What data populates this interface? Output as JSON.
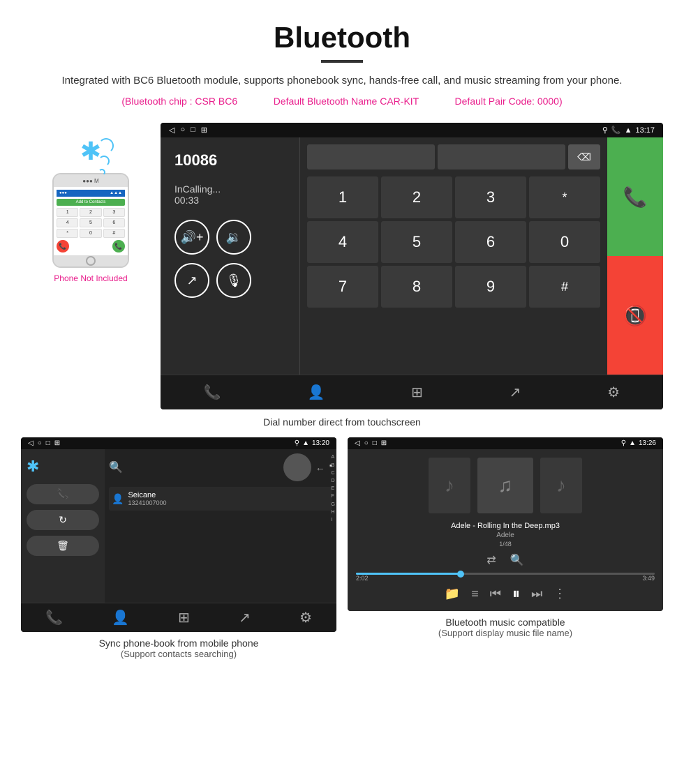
{
  "header": {
    "title": "Bluetooth",
    "description": "Integrated with BC6 Bluetooth module, supports phonebook sync, hands-free call, and music streaming from your phone.",
    "spec1": "(Bluetooth chip : CSR BC6",
    "spec2": "Default Bluetooth Name CAR-KIT",
    "spec3": "Default Pair Code: 0000)"
  },
  "phone": {
    "not_included": "Phone Not Included",
    "add_contacts": "Add to Contacts"
  },
  "car_screen": {
    "status": {
      "back": "◁",
      "home": "○",
      "recents": "□",
      "screenshot": "⊞",
      "location": "⚲",
      "phone": "📞",
      "signal": "▲",
      "time": "13:17"
    },
    "call": {
      "number": "10086",
      "status": "InCalling...",
      "timer": "00:33"
    },
    "dialpad": {
      "keys": [
        "1",
        "2",
        "3",
        "*",
        "4",
        "5",
        "6",
        "0",
        "7",
        "8",
        "9",
        "#"
      ]
    }
  },
  "dial_caption": "Dial number direct from touchscreen",
  "phonebook": {
    "status_time": "13:20",
    "contact_name": "Seicane",
    "contact_number": "13241007000",
    "alpha_list": [
      "*",
      "A",
      "B",
      "C",
      "D",
      "E",
      "F",
      "G",
      "H",
      "I"
    ],
    "caption_main": "Sync phone-book from mobile phone",
    "caption_sub": "(Support contacts searching)"
  },
  "music": {
    "status_time": "13:26",
    "track": "Adele - Rolling In the Deep.mp3",
    "artist": "Adele",
    "count": "1/48",
    "time_current": "2:02",
    "time_total": "3:49",
    "caption_main": "Bluetooth music compatible",
    "caption_sub": "(Support display music file name)"
  }
}
